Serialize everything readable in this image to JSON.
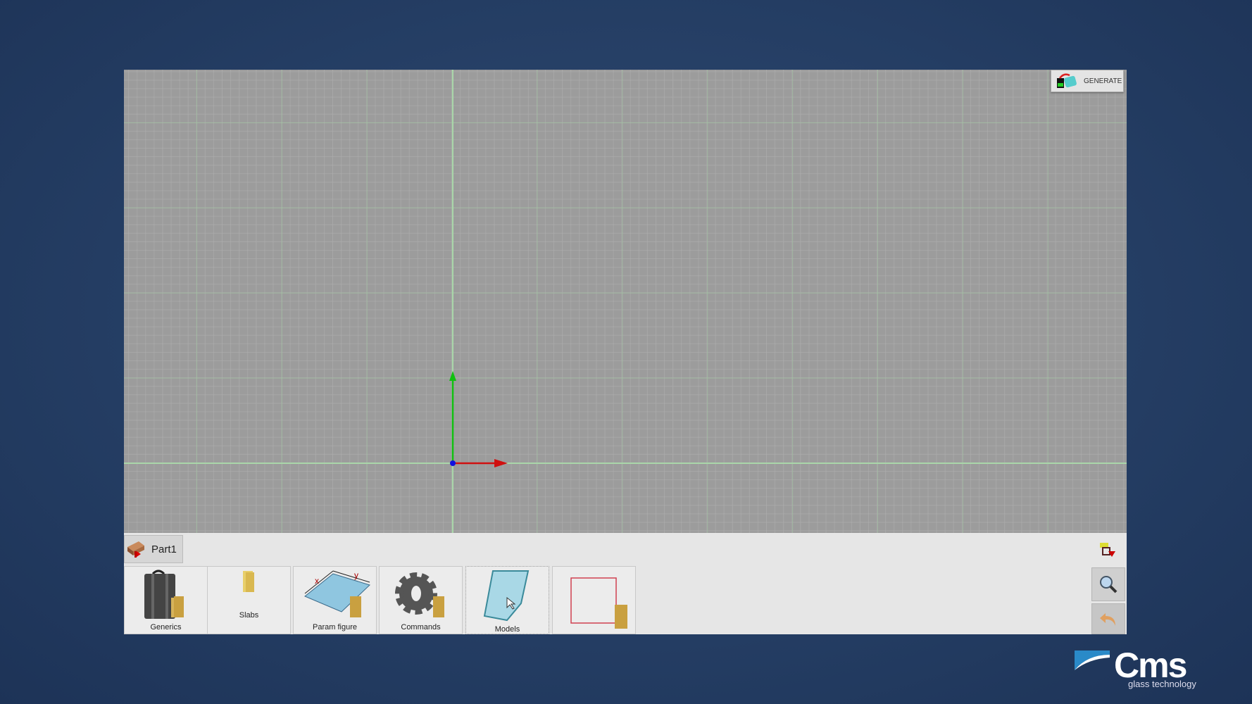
{
  "toolbar": {
    "generate_label": "GENERATE"
  },
  "part_tab": {
    "label": "Part1"
  },
  "buttons": [
    {
      "label": "Generics",
      "icon": "briefcase-folder-icon"
    },
    {
      "label": "Slabs",
      "icon": "folder-icon"
    },
    {
      "label": "Param figure",
      "icon": "param-figure-folder-icon"
    },
    {
      "label": "Commands",
      "icon": "gear-folder-icon"
    },
    {
      "label": "Models",
      "icon": "model-shape-icon"
    },
    {
      "label": "",
      "icon": "rectangle-folder-icon"
    }
  ],
  "side": {
    "zoom_icon": "magnifier-icon",
    "undo_icon": "undo-arrow-icon",
    "layers_icon": "layers-icon"
  },
  "logo": {
    "brand": "Cms",
    "tagline": "glass technology"
  },
  "colors": {
    "x_axis": "#d01010",
    "y_axis": "#10c010",
    "origin": "#1010e0",
    "background": "#243d63"
  }
}
